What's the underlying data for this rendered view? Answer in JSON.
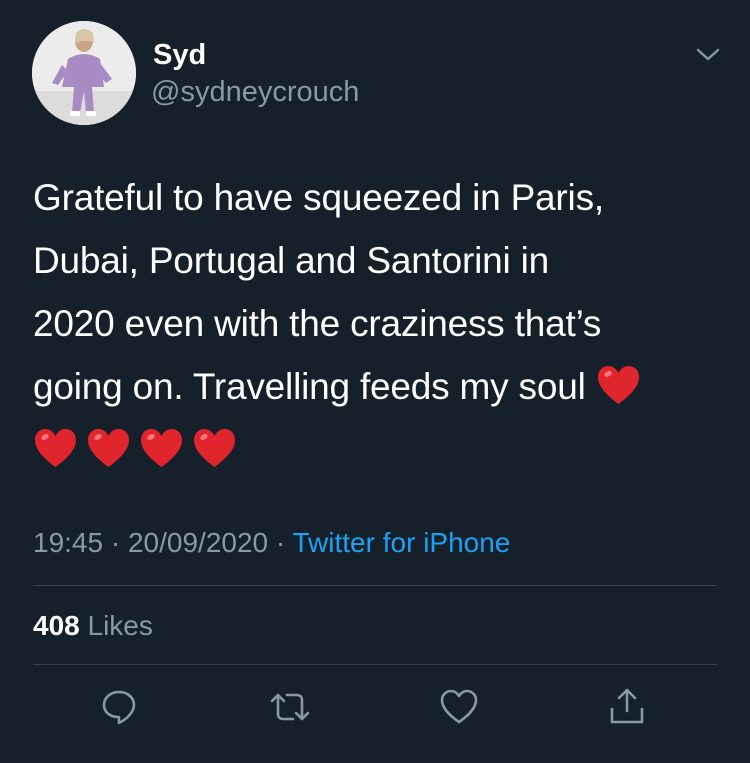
{
  "tweet": {
    "display_name": "Syd",
    "handle": "@sydneycrouch",
    "text_lines": [
      "Grateful to have squeezed in Paris,",
      "Dubai, Portugal and Santorini in",
      "2020 even with the craziness that’s",
      "going on. Travelling feeds my soul "
    ],
    "time": "19:45",
    "separator": " · ",
    "date": "20/09/2020",
    "source": "Twitter for iPhone",
    "likes_count": "408",
    "likes_label": "Likes"
  },
  "icons": {
    "menu": "chevron-down-icon",
    "reply": "reply-icon",
    "retweet": "retweet-icon",
    "like": "heart-icon",
    "share": "share-icon",
    "emoji": "red-heart-emoji"
  },
  "colors": {
    "background": "#15202b",
    "text": "#ffffff",
    "secondary": "#8899a6",
    "link": "#1da1f2",
    "divider": "#38444d",
    "emoji_heart": "#e0252d"
  }
}
